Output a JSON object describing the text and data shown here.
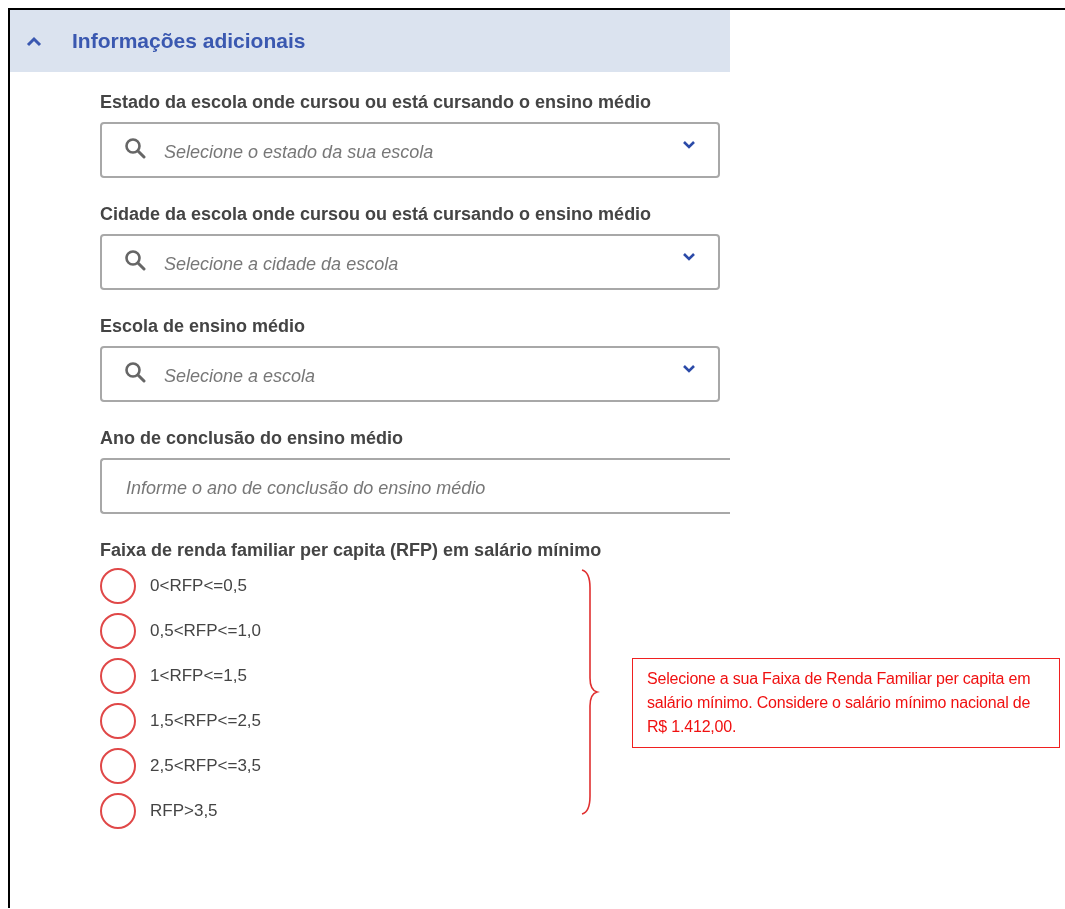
{
  "section": {
    "title": "Informações adicionais",
    "expanded": true
  },
  "fields": [
    {
      "kind": "select",
      "label": "Estado da escola onde cursou ou está cursando o ensino médio",
      "placeholder": "Selecione o estado da sua escola"
    },
    {
      "kind": "select",
      "label": "Cidade da escola onde cursou ou está cursando o ensino médio",
      "placeholder": "Selecione a cidade da escola"
    },
    {
      "kind": "select",
      "label": "Escola de ensino médio",
      "placeholder": "Selecione a escola"
    },
    {
      "kind": "text",
      "label": "Ano de conclusão do ensino médio",
      "placeholder": "Informe o ano de conclusão do ensino médio"
    }
  ],
  "income": {
    "label": "Faixa de renda familiar per capita (RFP) em salário mínimo",
    "options": [
      {
        "label": "0<RFP<=0,5",
        "selected": false
      },
      {
        "label": "0,5<RFP<=1,0",
        "selected": false
      },
      {
        "label": "1<RFP<=1,5",
        "selected": false
      },
      {
        "label": "1,5<RFP<=2,5",
        "selected": false
      },
      {
        "label": "2,5<RFP<=3,5",
        "selected": false
      },
      {
        "label": "RFP>3,5",
        "selected": false
      }
    ]
  },
  "annotation": {
    "text": "Selecione a sua Faixa de Renda Familiar per capita em salário mínimo. Considere o salário mínimo nacional de R$ 1.412,00."
  }
}
